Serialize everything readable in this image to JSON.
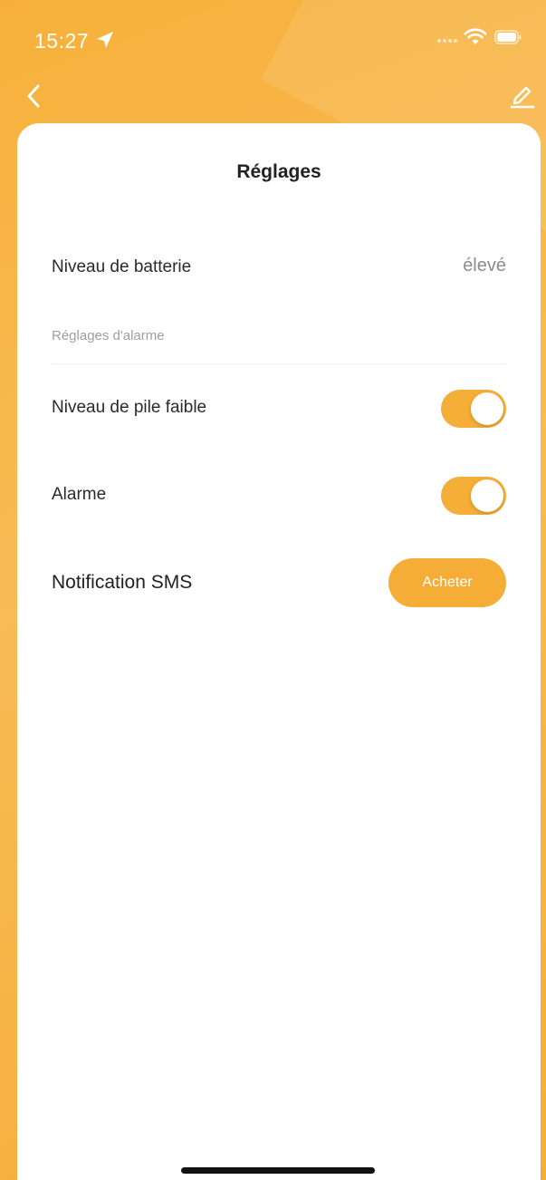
{
  "status_bar": {
    "time": "15:27",
    "icons": [
      "location-arrow-icon",
      "signal-dots-icon",
      "wifi-icon",
      "battery-icon"
    ]
  },
  "nav": {
    "icons": [
      "back-chevron-icon",
      "edit-pencil-icon"
    ]
  },
  "page": {
    "title": "Réglages"
  },
  "battery": {
    "label": "Niveau de batterie",
    "value": "élevé"
  },
  "alarm_settings": {
    "section_header": "Réglages d'alarme",
    "items": [
      {
        "label": "Niveau de pile faible",
        "enabled": true
      },
      {
        "label": "Alarme",
        "enabled": true
      }
    ]
  },
  "sms": {
    "label": "Notification SMS",
    "button_label": "Acheter"
  },
  "colors": {
    "accent": "#f6ad37",
    "header_gradient_start": "#f7b13b",
    "header_gradient_end": "#f6ad38",
    "text_primary": "#2a2a2a",
    "text_secondary": "#8c8c8c",
    "section_header": "#9e9e9e"
  }
}
